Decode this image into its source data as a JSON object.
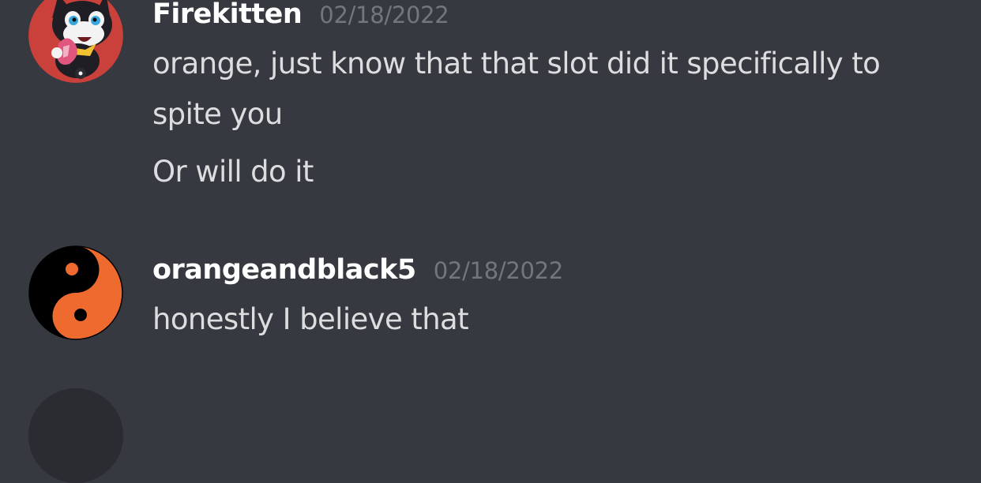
{
  "messages": [
    {
      "username": "Firekitten",
      "timestamp": "02/18/2022",
      "lines": [
        "orange, just know that that slot did it specifically to",
        "spite you",
        "Or will do it"
      ],
      "avatar_icon": "cat-mascot-avatar",
      "avatar_bg": "#c9413a"
    },
    {
      "username": "orangeandblack5",
      "timestamp": "02/18/2022",
      "lines": [
        "honestly I believe that"
      ],
      "avatar_icon": "yin-yang-avatar",
      "avatar_colors": [
        "#000000",
        "#ef6a2f"
      ]
    }
  ],
  "colors": {
    "background": "#36393f",
    "username": "#ffffff",
    "timestamp": "#72767d",
    "message_text": "#dcddde"
  }
}
